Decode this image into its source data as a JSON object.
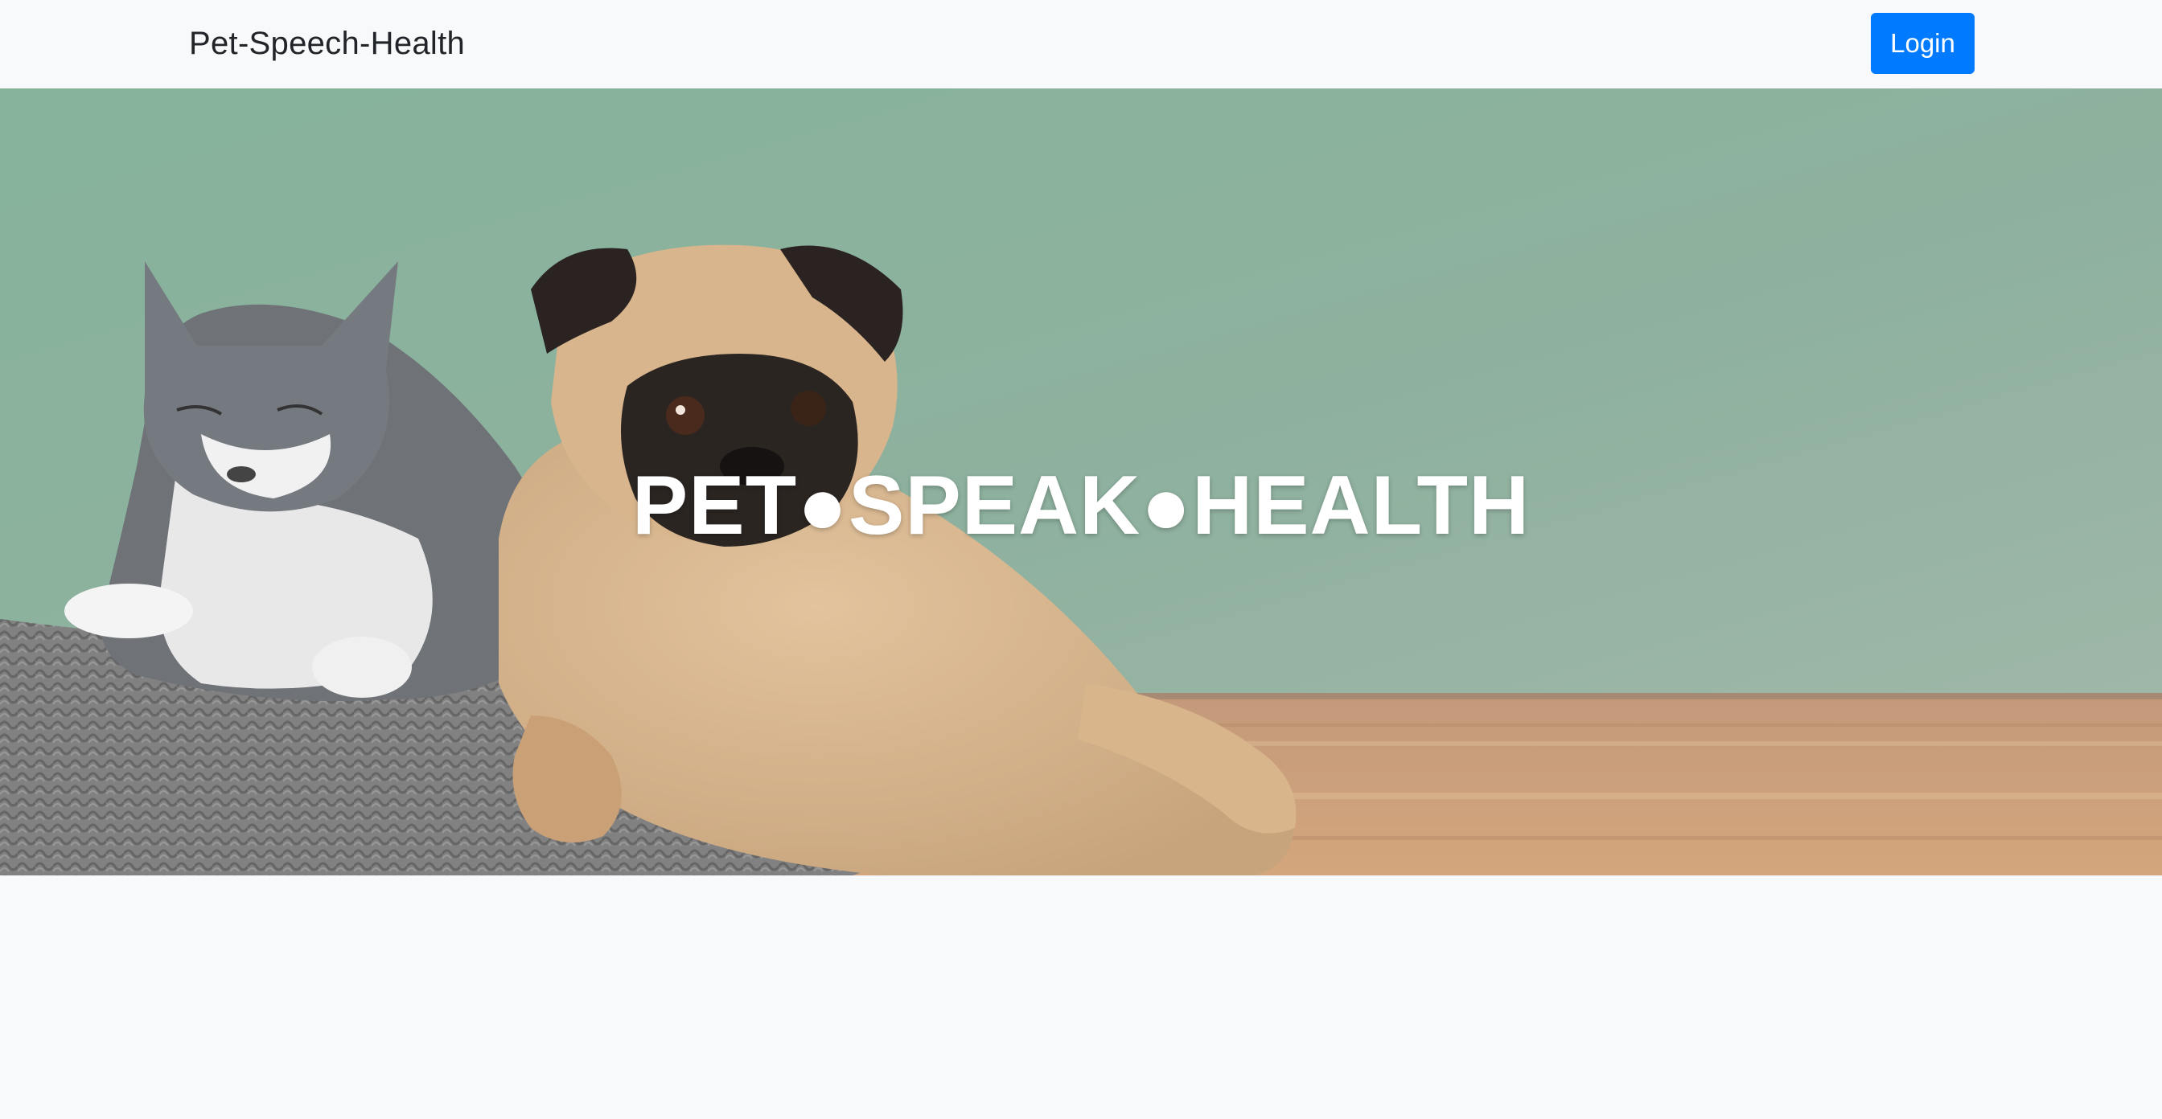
{
  "navbar": {
    "brand": "Pet-Speech-Health",
    "login_label": "Login"
  },
  "hero": {
    "title": "PET●SPEAK●HEALTH",
    "image_alt": "Gray and white cat and a pug lying on a knitted pillow"
  },
  "colors": {
    "primary_button": "#007bff",
    "navbar_bg": "#f8f9fa",
    "wall": "#8fb4a2",
    "floor": "#c49a76"
  }
}
